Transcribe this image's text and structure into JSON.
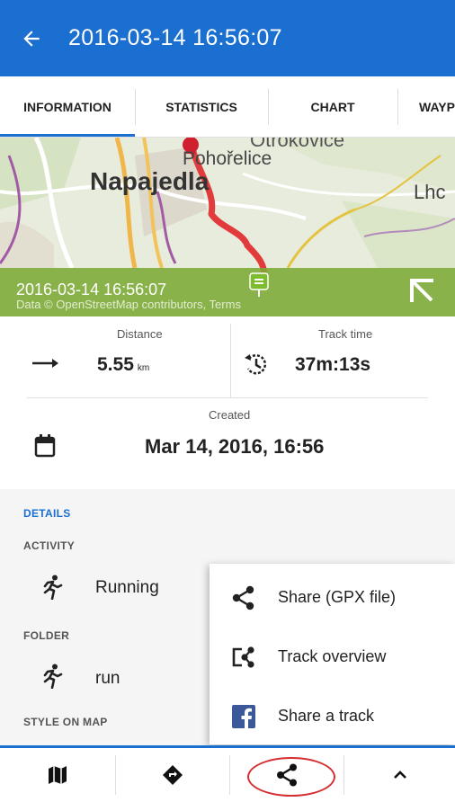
{
  "appbar": {
    "back_icon": "arrow-left-icon",
    "title": "2016-03-14 16:56:07"
  },
  "tabs": [
    {
      "label": "INFORMATION",
      "active": true
    },
    {
      "label": "STATISTICS",
      "active": false
    },
    {
      "label": "CHART",
      "active": false
    },
    {
      "label": "WAYP",
      "active": false
    }
  ],
  "map": {
    "labels": {
      "town_main": "Napajedla",
      "town_village": "Pohořelice",
      "town_right": "Lhc",
      "town_top": "Otrokovice"
    },
    "banner_date": "2016-03-14 16:56:07",
    "attribution": "Data © OpenStreetMap contributors, Terms",
    "colors": {
      "track": "#e23b3b",
      "banner": "#7caa35"
    }
  },
  "stats": {
    "distance": {
      "label": "Distance",
      "value": "5.55",
      "unit": "km",
      "icon": "arrow-right-icon"
    },
    "track_time": {
      "label": "Track time",
      "value": "37m:13s",
      "icon": "history-icon"
    },
    "created": {
      "label": "Created",
      "value": "Mar 14, 2016, 16:56",
      "icon": "calendar-icon"
    }
  },
  "details": {
    "header": "DETAILS",
    "activity": {
      "header": "ACTIVITY",
      "value": "Running",
      "icon": "running-icon"
    },
    "folder": {
      "header": "FOLDER",
      "value": "run",
      "icon": "running-icon"
    },
    "style_header": "STYLE ON MAP"
  },
  "popup": {
    "items": [
      {
        "label": "Share (GPX file)",
        "icon": "share-icon"
      },
      {
        "label": "Track overview",
        "icon": "track-overview-icon"
      },
      {
        "label": "Share a track",
        "icon": "facebook-icon"
      }
    ]
  },
  "bottombar": {
    "buttons": [
      {
        "icon": "map-icon"
      },
      {
        "icon": "navigation-icon"
      },
      {
        "icon": "share-icon"
      },
      {
        "icon": "chevron-up-icon"
      }
    ]
  },
  "colors": {
    "primary": "#1b6fd1",
    "highlight_circle": "#d62f2f"
  }
}
